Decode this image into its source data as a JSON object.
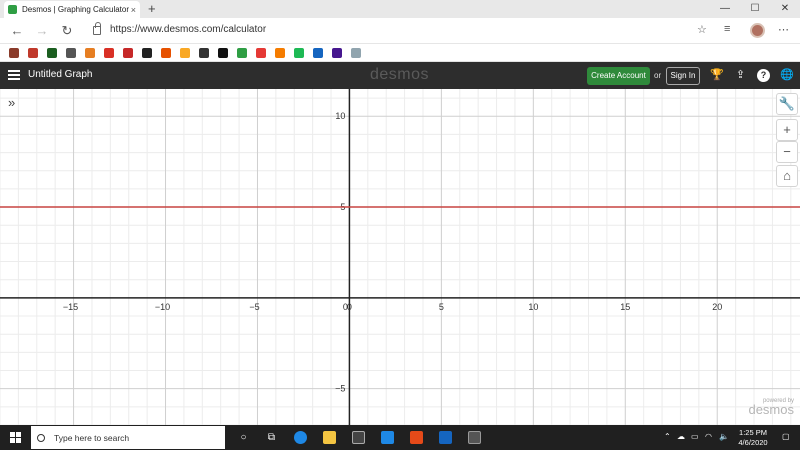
{
  "browser": {
    "tab_title": "Desmos | Graphing Calculator",
    "tab_close": "×",
    "new_tab": "+",
    "url": "https://www.desmos.com/calculator",
    "window_controls": [
      "—",
      "☐",
      "✕"
    ]
  },
  "favorites": [
    {
      "icon": "favicon-1",
      "color": "#8a3b2a"
    },
    {
      "icon": "favicon-2",
      "color": "#c0392b"
    },
    {
      "icon": "favicon-3",
      "color": "#1b5e20"
    },
    {
      "icon": "favicon-4",
      "color": "#555555"
    },
    {
      "icon": "favicon-5",
      "color": "#e67e22"
    },
    {
      "icon": "gmail-icon",
      "color": "#d93025"
    },
    {
      "icon": "favicon-7",
      "color": "#c62828"
    },
    {
      "icon": "amazon-icon",
      "color": "#222222"
    },
    {
      "icon": "favicon-9",
      "color": "#e65100"
    },
    {
      "icon": "favicon-10",
      "color": "#f9a825"
    },
    {
      "icon": "favicon-11",
      "color": "#333333"
    },
    {
      "icon": "favicon-12",
      "color": "#111111"
    },
    {
      "icon": "favicon-13",
      "color": "#2f9e44"
    },
    {
      "icon": "youtube-icon",
      "color": "#e53935"
    },
    {
      "icon": "favicon-15",
      "color": "#f57c00"
    },
    {
      "icon": "spotify-icon",
      "color": "#1db954"
    },
    {
      "icon": "quizlet-icon",
      "color": "#1565c0"
    },
    {
      "icon": "kahoot-icon",
      "color": "#46178f"
    },
    {
      "icon": "favicon-19",
      "color": "#90a4ae"
    }
  ],
  "header": {
    "graph_title": "Untitled Graph",
    "logo": "desmos",
    "create_account": "Create Account",
    "or": "or",
    "sign_in": "Sign In",
    "help_glyph": "?"
  },
  "graph": {
    "line_color": "#c74440",
    "zoom_in": "+",
    "zoom_out": "−",
    "powered_by": "powered by",
    "powered_logo": "desmos"
  },
  "chart_data": {
    "type": "line",
    "xlim": [
      -19,
      24.5
    ],
    "ylim": [
      -7,
      11.5
    ],
    "x_ticks": [
      -15,
      -10,
      -5,
      0,
      5,
      10,
      15,
      20
    ],
    "y_ticks": [
      -5,
      5,
      10
    ],
    "grid": true,
    "series": [
      {
        "expression": "y = 5",
        "color": "#c74440",
        "x": [
          -19,
          24.5
        ],
        "y": [
          5,
          5
        ]
      }
    ]
  },
  "taskbar": {
    "search_placeholder": "Type here to search",
    "time": "1:25 PM",
    "date": "4/6/2020",
    "notification_count": "1"
  }
}
